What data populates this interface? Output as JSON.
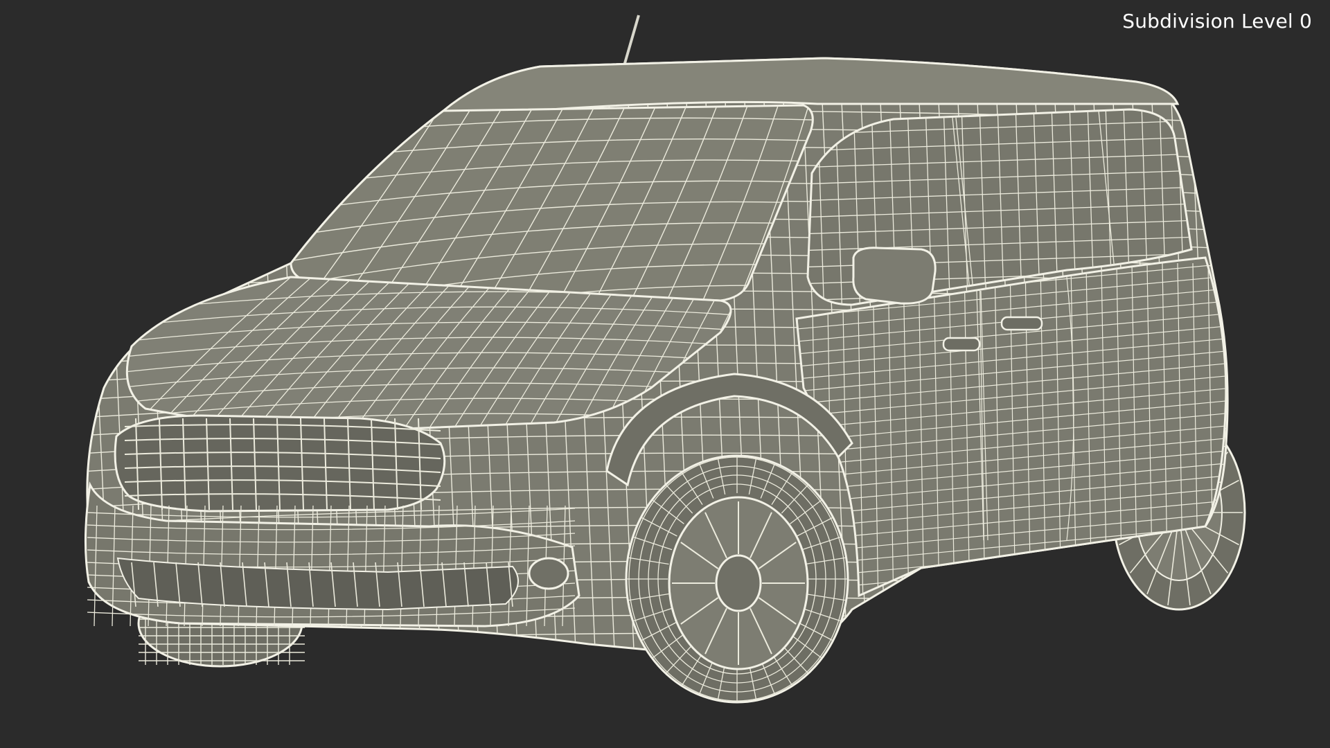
{
  "overlay": {
    "label": "Subdivision Level 0"
  },
  "model": {
    "subject": "van-wireframe",
    "surface_color": "#7d7d72",
    "surface_dark": "#5f5f57",
    "wire_color": "#f2f1e6",
    "background": "#2b2b2b"
  }
}
